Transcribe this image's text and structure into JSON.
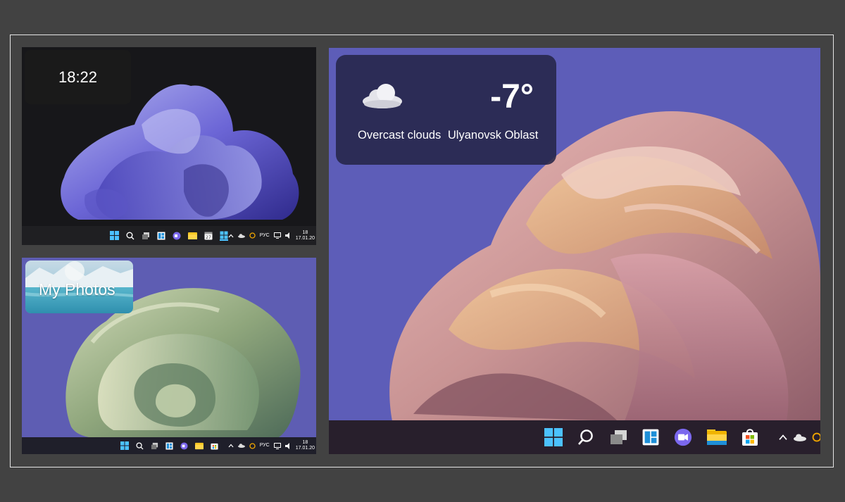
{
  "panels": {
    "dark": {
      "clock_widget": {
        "time": "18:22"
      },
      "tray": {
        "language": "РУС",
        "time": "18",
        "date": "17.01.20"
      }
    },
    "photos": {
      "photos_widget": {
        "label": "My Photos"
      },
      "tray": {
        "language": "РУС",
        "time": "18",
        "date": "17.01.20"
      }
    },
    "weather": {
      "weather_widget": {
        "temperature": "-7°",
        "condition": "Overcast clouds",
        "location": "Ulyanovsk Oblast",
        "icon": "cloud-icon"
      }
    }
  },
  "taskbar_icons": [
    "start-icon",
    "search-icon",
    "task-view-icon",
    "widgets-icon",
    "chat-icon",
    "file-explorer-icon",
    "store-icon"
  ],
  "colors": {
    "frame_border": "#e6e6e6",
    "background": "#424242",
    "weather_card": "#262548",
    "accent_blue": "#3fa9f5"
  }
}
